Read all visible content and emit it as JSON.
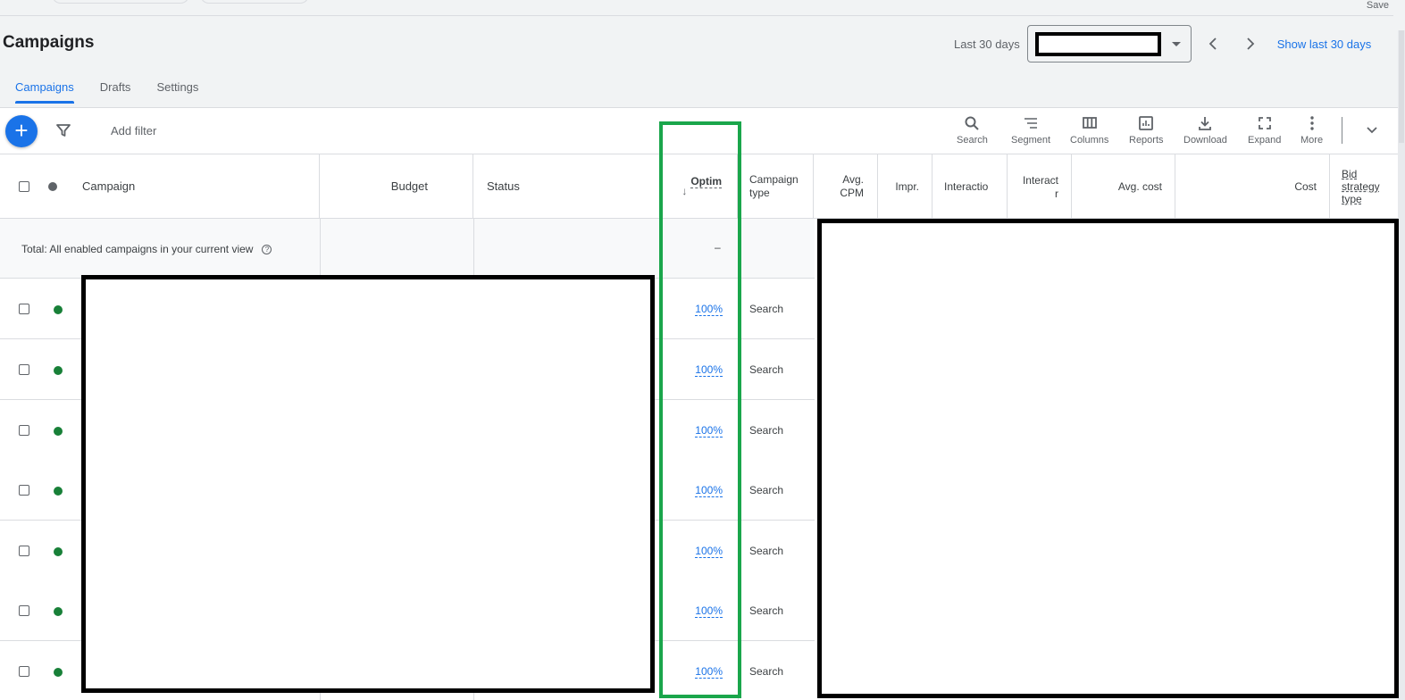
{
  "header": {
    "save_label": "Save",
    "page_title": "Campaigns",
    "date_range_label": "Last 30 days",
    "date_range_value": "",
    "show_last_link": "Show last 30 days"
  },
  "tabs": [
    {
      "label": "Campaigns",
      "active": true
    },
    {
      "label": "Drafts",
      "active": false
    },
    {
      "label": "Settings",
      "active": false
    }
  ],
  "toolbar": {
    "add_filter_label": "Add filter",
    "buttons": [
      {
        "label": "Search",
        "icon": "search-icon"
      },
      {
        "label": "Segment",
        "icon": "segment-icon"
      },
      {
        "label": "Columns",
        "icon": "columns-icon"
      },
      {
        "label": "Reports",
        "icon": "reports-icon"
      },
      {
        "label": "Download",
        "icon": "download-icon"
      },
      {
        "label": "Expand",
        "icon": "expand-icon"
      },
      {
        "label": "More",
        "icon": "more-vert-icon"
      }
    ]
  },
  "table": {
    "columns": {
      "campaign": "Campaign",
      "budget": "Budget",
      "status": "Status",
      "optimization": "Optim",
      "campaign_type": "Campaign type",
      "avg_cpm": "Avg. CPM",
      "impr": "Impr.",
      "interactions": "Interactio",
      "interaction_rate": "Interact r",
      "avg_cost": "Avg. cost",
      "cost": "Cost",
      "bid_strategy": "Bid strategy type"
    },
    "sort_column": "optimization",
    "sort_direction": "descending",
    "total_row": {
      "label": "Total: All enabled campaigns in your current view",
      "optimization": "–"
    },
    "rows": [
      {
        "status": "enabled",
        "optimization": "100%",
        "campaign_type": "Search"
      },
      {
        "status": "enabled",
        "optimization": "100%",
        "campaign_type": "Search"
      },
      {
        "status": "enabled",
        "optimization": "100%",
        "campaign_type": "Search"
      },
      {
        "status": "enabled",
        "optimization": "100%",
        "campaign_type": "Search"
      },
      {
        "status": "enabled",
        "optimization": "100%",
        "campaign_type": "Search"
      },
      {
        "status": "enabled",
        "optimization": "100%",
        "campaign_type": "Search"
      },
      {
        "status": "enabled",
        "optimization": "100%",
        "campaign_type": "Search"
      }
    ]
  },
  "colors": {
    "accent": "#1a73e8",
    "enabled": "#188038",
    "highlight": "#1aa64b"
  }
}
